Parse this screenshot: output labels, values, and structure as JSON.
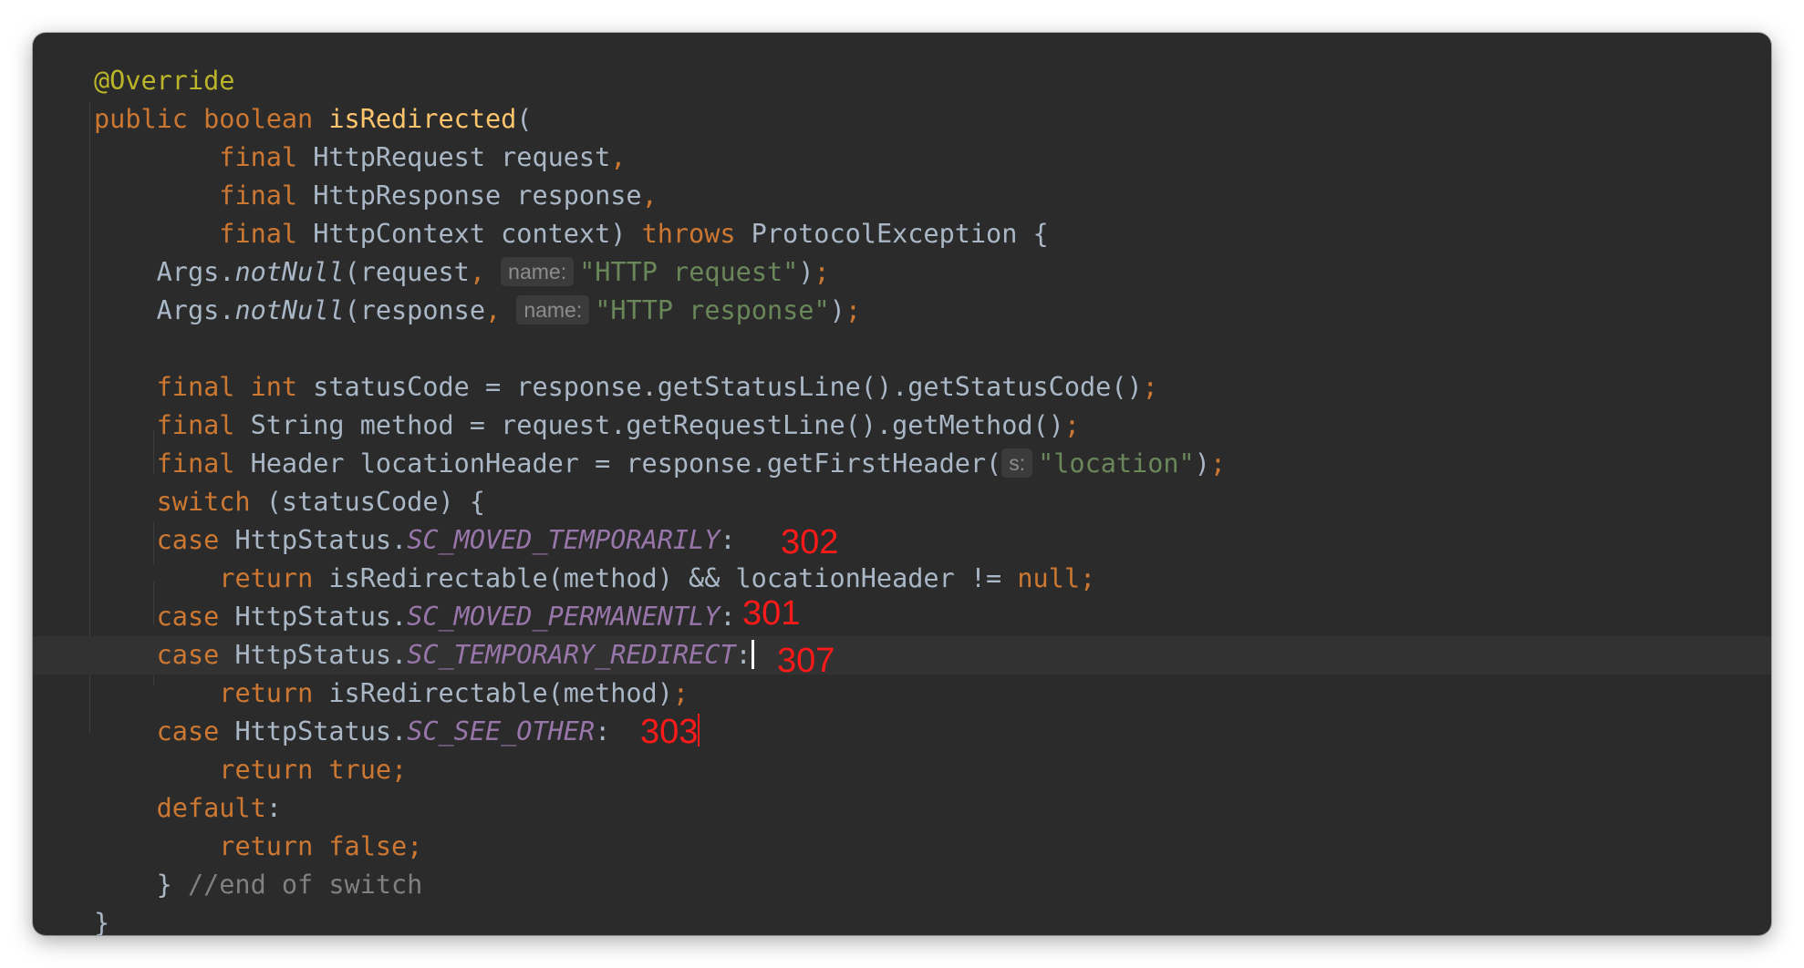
{
  "code_lines": [
    "@Override",
    "public boolean isRedirected(",
    "final HttpRequest request,",
    "final HttpResponse response,",
    "final HttpContext context) throws ProtocolException {",
    "Args.notNull(request, name: \"HTTP request\");",
    "Args.notNull(response, name: \"HTTP response\");",
    "",
    "final int statusCode = response.getStatusLine().getStatusCode();",
    "final String method = request.getRequestLine().getMethod();",
    "final Header locationHeader = response.getFirstHeader( s: \"location\");",
    "switch (statusCode) {",
    "case HttpStatus.SC_MOVED_TEMPORARILY:",
    "return isRedirectable(method) && locationHeader != null;",
    "case HttpStatus.SC_MOVED_PERMANENTLY:",
    "case HttpStatus.SC_TEMPORARY_REDIRECT:",
    "return isRedirectable(method);",
    "case HttpStatus.SC_SEE_OTHER:",
    "return true;",
    "default:",
    "return false;",
    "} //end of switch",
    "}"
  ],
  "annotations": {
    "moved_temporarily": "302",
    "moved_permanently": "301",
    "temporary_redirect": "307",
    "see_other": "303"
  },
  "colors": {
    "background": "#2b2b2b",
    "keyword": "#cc7832",
    "annotation": "#bbb529",
    "method_declaration": "#ffc66d",
    "string": "#6a8759",
    "constant": "#9876aa",
    "plain": "#a9b7c6",
    "comment": "#808080",
    "handwritten_note": "#ff1a1a"
  }
}
